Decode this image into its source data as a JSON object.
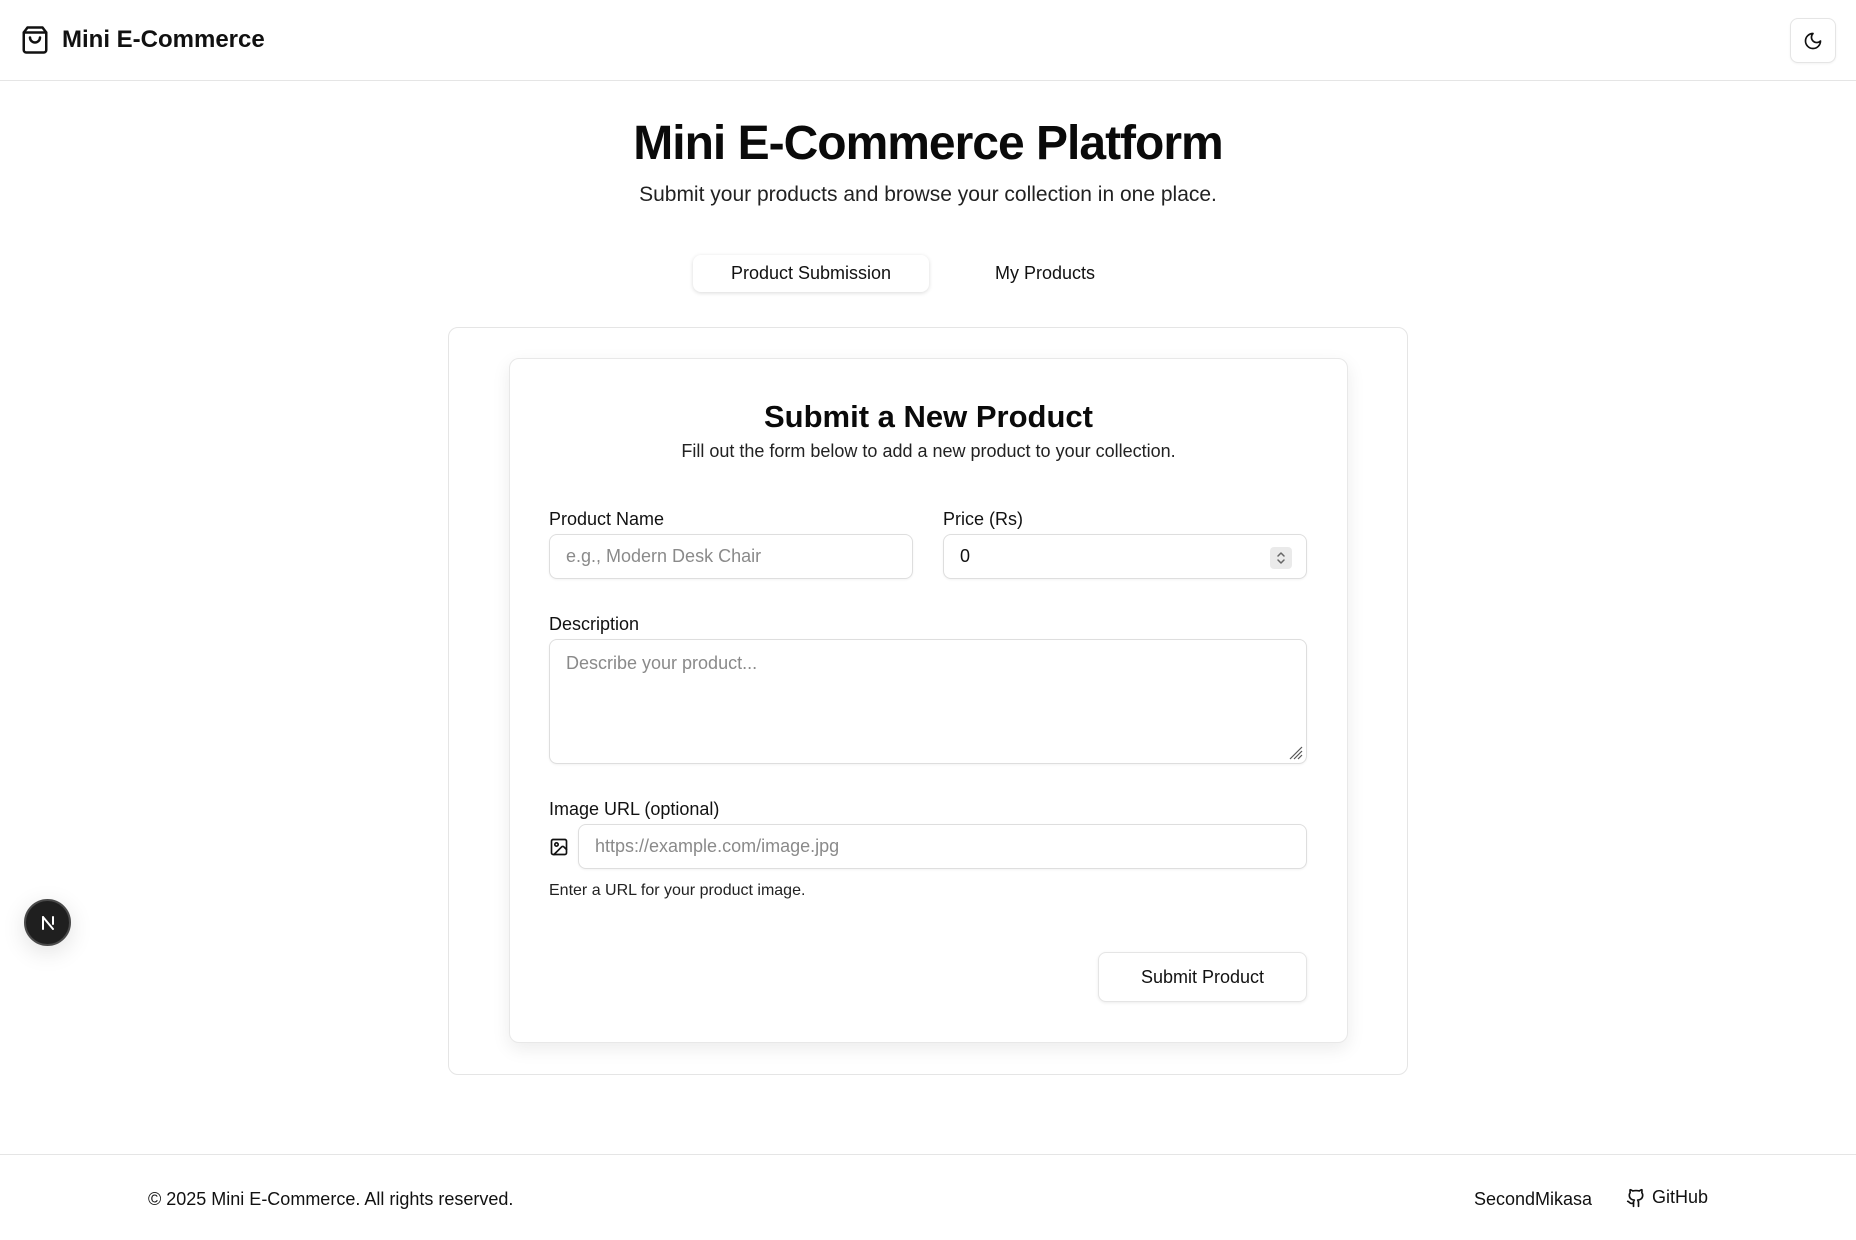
{
  "header": {
    "brand_name": "Mini E-Commerce",
    "brand_icon": "shopping-bag-icon",
    "theme_toggle_icon": "moon-icon"
  },
  "hero": {
    "title": "Mini E-Commerce Platform",
    "subtitle": "Submit your products and browse your collection in one place."
  },
  "tabs": [
    {
      "label": "Product Submission",
      "active": true
    },
    {
      "label": "My Products",
      "active": false
    }
  ],
  "form": {
    "title": "Submit a New Product",
    "subtitle": "Fill out the form below to add a new product to your collection.",
    "product_name": {
      "label": "Product Name",
      "placeholder": "e.g., Modern Desk Chair",
      "value": ""
    },
    "price": {
      "label": "Price (Rs)",
      "value": "0"
    },
    "description": {
      "label": "Description",
      "placeholder": "Describe your product...",
      "value": ""
    },
    "image_url": {
      "label": "Image URL (optional)",
      "placeholder": "https://example.com/image.jpg",
      "value": "",
      "helper": "Enter a URL for your product image.",
      "icon": "image-icon"
    },
    "submit_label": "Submit Product"
  },
  "badge": {
    "letter": "N"
  },
  "footer": {
    "copyright": "© 2025 Mini E-Commerce. All rights reserved.",
    "author": "SecondMikasa",
    "github_label": "GitHub",
    "github_icon": "github-icon"
  }
}
